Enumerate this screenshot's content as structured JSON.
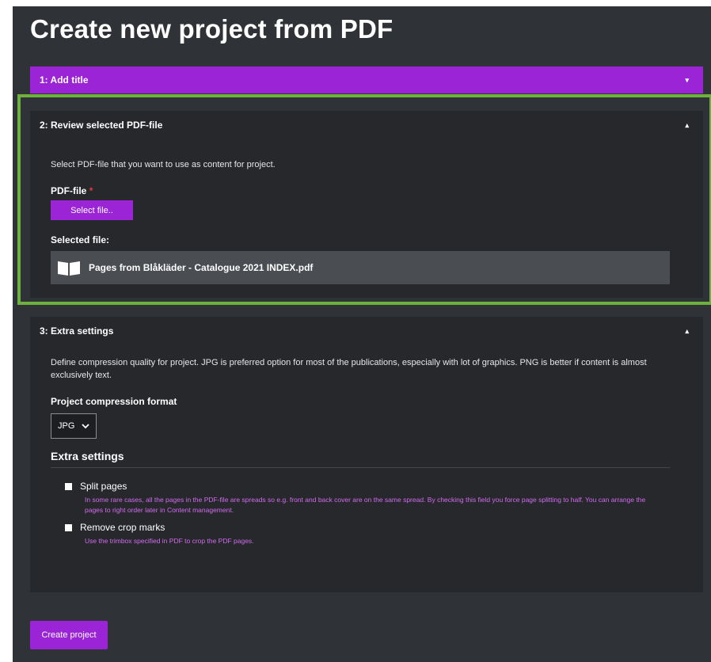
{
  "page": {
    "title": "Create new project from PDF"
  },
  "steps": {
    "step1": {
      "label": "1: Add title",
      "caret": "▾"
    },
    "step2": {
      "label": "2: Review selected PDF-file",
      "caret": "▴",
      "description": "Select PDF-file that you want to use as content for project.",
      "pdf_label": "PDF-file",
      "required_mark": "*",
      "select_button": "Select file..",
      "selected_label": "Selected file:",
      "selected_file": "Pages from Blåkläder - Catalogue 2021 INDEX.pdf"
    },
    "step3": {
      "label": "3: Extra settings",
      "caret": "▴",
      "description": "Define compression quality for project. JPG is preferred option for most of the publications, especially with lot of graphics. PNG is better if content is almost exclusively text.",
      "format_label": "Project compression format",
      "format_value": "JPG",
      "extra_heading": "Extra settings",
      "split_label": "Split pages",
      "split_help": "In some rare cases, all the pages in the PDF-file are spreads so e.g. front and back cover are on the same spread. By checking this field you force page splitting to half. You can arrange the pages to right order later in Content management.",
      "crop_label": "Remove crop marks",
      "crop_help": "Use the trimbox specified in PDF to crop the PDF pages."
    }
  },
  "actions": {
    "create": "Create project"
  },
  "colors": {
    "accent": "#9a24d6",
    "background": "#2f3236",
    "panel": "#26282c",
    "highlight_frame": "#6eb13f",
    "help_text": "#d36bf0"
  },
  "icons": {
    "file": "book-icon",
    "dropdown": "chevron-down-icon"
  }
}
